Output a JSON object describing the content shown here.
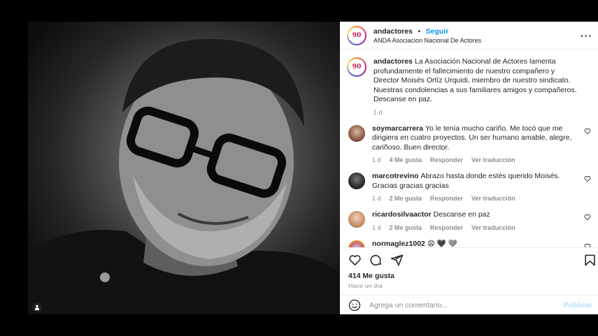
{
  "post": {
    "username": "andactores",
    "separator": "•",
    "follow_label": "Seguir",
    "subtitle": "ANDA Asociacion Nacional De Actores",
    "avatar_text": "90",
    "more_icon": "more-horizontal-icon"
  },
  "caption": {
    "username": "andactores",
    "text": "La Asociación Nacional de Actores lamenta profundamente el fallecimiento de nuestro compañero y Director Moisés Ortíz Urquidi, miembro de nuestro sindicato. Nuestras condolencias a sus familiares amigos y compañeros. Descanse en paz.",
    "time": "1 d"
  },
  "comments": [
    {
      "username": "soymarcarrera",
      "text": "Yo le tenía mucho cariño. Me tocó que me dirigiera en cuatro proyectos. Un ser humano amable, alegre, cariñoso. Buen director.",
      "time": "1 d",
      "likes": "4 Me gusta",
      "reply": "Responder",
      "translate": "Ver traducción",
      "avatar_color": "#8a5a44"
    },
    {
      "username": "marcotrevino",
      "text": "Abrazo hasta donde estés querido Moisés. Gracias gracias gracias",
      "time": "1 d",
      "likes": "2 Me gusta",
      "reply": "Responder",
      "translate": "Ver traducción",
      "avatar_color": "#2b2b2b"
    },
    {
      "username": "ricardosilvaactor",
      "text": "Descanse en paz",
      "time": "1 d",
      "likes": "2 Me gusta",
      "reply": "Responder",
      "translate": "Ver traducción",
      "avatar_color": "#c98f6a"
    },
    {
      "username": "normaglez1002",
      "text": "😩 🖤 🩶",
      "avatar_color": "#b0607a"
    }
  ],
  "footer": {
    "likes": "414 Me gusta",
    "time": "Hace un día",
    "comment_placeholder": "Agrega un comentario...",
    "publish_label": "Publicar"
  },
  "colors": {
    "link_blue": "#0095f6",
    "publish_disabled": "#b2dffc",
    "muted_text": "#8e8e8e"
  }
}
